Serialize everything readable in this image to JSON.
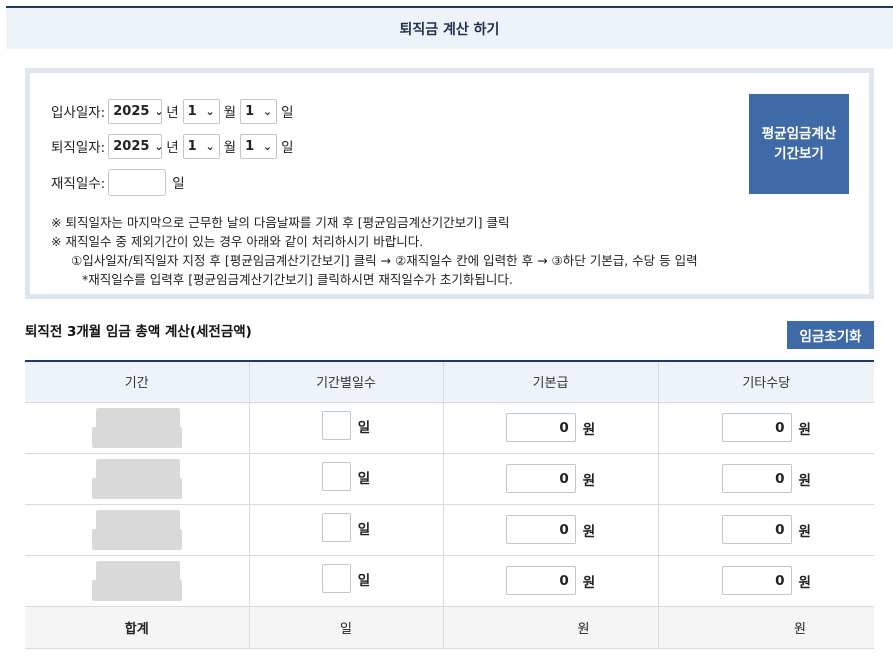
{
  "page_title": "퇴직금 계산 하기",
  "form": {
    "join_label": "입사일자:",
    "leave_label": "퇴직일자:",
    "work_days_label": "재직일수:",
    "year_unit": "년",
    "month_unit": "월",
    "day_unit": "일",
    "join": {
      "year": "2025",
      "month": "1",
      "day": "1"
    },
    "leave": {
      "year": "2025",
      "month": "1",
      "day": "1"
    },
    "work_days_unit": "일"
  },
  "period_button": {
    "line1": "평균임금계산",
    "line2": "기간보기"
  },
  "notes": [
    "※ 퇴직일자는 마지막으로 근무한 날의 다음날짜를 기재 후 [평균임금계산기간보기] 클릭",
    "※ 재직일수 중 제외기간이 있는 경우 아래와 같이 처리하시기 바랍니다.",
    "①입사일자/퇴직일자 지정 후 [평균임금계산기간보기] 클릭 → ②재직일수 칸에 입력한 후 → ③하단 기본급, 수당 등 입력",
    "*재직일수를 입력후 [평균임금계산기간보기] 클릭하시면 재직일수가 초기화됩니다."
  ],
  "section_title": "퇴직전 3개월 임금 총액 계산(세전금액)",
  "reset_button": "임금초기화",
  "table": {
    "headers": [
      "기간",
      "기간별일수",
      "기본급",
      "기타수당"
    ],
    "rows": [
      {
        "basic": "0",
        "other": "0"
      },
      {
        "basic": "0",
        "other": "0"
      },
      {
        "basic": "0",
        "other": "0"
      },
      {
        "basic": "0",
        "other": "0"
      }
    ],
    "day_unit": "일",
    "won_unit": "원",
    "sum": {
      "label": "합계",
      "day_unit": "일",
      "basic_unit": "원",
      "other_unit": "원"
    }
  },
  "icons": {
    "dropdown": "chevron-down-icon"
  },
  "colors": {
    "accent": "#3f6aa8",
    "header_bg": "#eef3fa",
    "border_top": "#1f3a66"
  }
}
